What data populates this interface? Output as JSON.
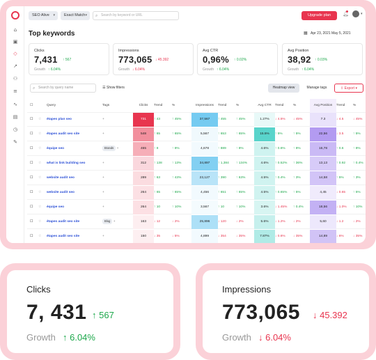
{
  "topbar": {
    "project": "SEO Alive",
    "match": "Exact Match",
    "search_placeholder": "Search by keyword or URL",
    "upgrade": "Upgrade plan"
  },
  "page": {
    "title": "Top keywords",
    "date_range": "Apr 23, 2021   May 5, 2021"
  },
  "metrics": [
    {
      "label": "Clicks",
      "value": "7,431",
      "change": "↑ 567",
      "change_dir": "up",
      "growth_label": "Growth",
      "growth": "↑ 6.04%",
      "growth_dir": "up"
    },
    {
      "label": "Impressions",
      "value": "773,065",
      "change": "↓ 45.392",
      "change_dir": "down",
      "growth_label": "Growth",
      "growth": "↓ 6.04%",
      "growth_dir": "down"
    },
    {
      "label": "Avg CTR",
      "value": "0,96%",
      "change": "↑ 0.02%",
      "change_dir": "up",
      "growth_label": "Growth",
      "growth": "↑ 6.04%",
      "growth_dir": "up"
    },
    {
      "label": "Avg Position",
      "value": "38,92",
      "change": "↑ 0.03%",
      "change_dir": "up",
      "growth_label": "Growth",
      "growth": "↑ 6.04%",
      "growth_dir": "up"
    }
  ],
  "controls": {
    "query_search": "Search by query name",
    "show_filters": "Show filters",
    "heatmap": "Heatmap view",
    "manage_tags": "Manage tags",
    "export": "Export"
  },
  "table": {
    "headers": [
      "Query",
      "Tags",
      "Clicks",
      "Trend",
      "%",
      "Impressions",
      "Trend",
      "%",
      "Avg CTR",
      "Trend",
      "%",
      "Avg Position",
      "Trend",
      "%"
    ],
    "rows": [
      {
        "query": "étapes plan seo",
        "tag": "",
        "clicks": "731",
        "ctrend": "↑ 43",
        "cpct": "↑ 45%",
        "impr": "37,567",
        "itrend": "↑ 455",
        "ipct": "↑ 45%",
        "ctr": "1.27%",
        "trtrend": "↓ 4.5%",
        "trpct": "↓ 45%",
        "pos": "7.3",
        "ptrend": "↓ 4.5",
        "ppct": "↓ 45%"
      },
      {
        "query": "étapes audit seo site",
        "tag": "",
        "clicks": "548",
        "ctrend": "↑ 65",
        "cpct": "↑ 65%",
        "impr": "5,567",
        "itrend": "↑ 653",
        "ipct": "↑ 65%",
        "ctr": "15.5%",
        "trtrend": "↑ 5%",
        "trpct": "↑ 5%",
        "pos": "22,56",
        "ptrend": "↓ 3.5",
        "ppct": "↑ 5%"
      },
      {
        "query": "équipe seo",
        "tag": "Brands",
        "clicks": "465",
        "ctrend": "↑ 8",
        "cpct": "↑ 8%",
        "impr": "4,678",
        "itrend": "↑ 889",
        "ipct": "↑ 8%",
        "ctr": "4.6%",
        "trtrend": "↑ 0.6%",
        "trpct": "↑ 8%",
        "pos": "16,78",
        "ptrend": "↑ 0.6",
        "ppct": "↑ 8%"
      },
      {
        "query": "what is link building seo",
        "tag": "",
        "clicks": "312",
        "ctrend": "↑ 138",
        "cpct": "↑ 13%",
        "impr": "34,897",
        "itrend": "↑ 1,384",
        "ipct": "↑ 134%",
        "ctr": "4.6%",
        "trtrend": "↑ 0.52%",
        "trpct": "↑ 36%",
        "pos": "13,13",
        "ptrend": "↑ 0.92",
        "ppct": "↑ 0.4%"
      },
      {
        "query": "website audit seo",
        "tag": "",
        "clicks": "289",
        "ctrend": "↑ 63",
        "cpct": "↑ 43%",
        "impr": "23,127",
        "itrend": "↑ 390",
        "ipct": "↑ 63%",
        "ctr": "4.5%",
        "trtrend": "↑ 0.4%",
        "trpct": "↑ 3%",
        "pos": "14,58",
        "ptrend": "↑ 5%",
        "ppct": "↑ 3%"
      },
      {
        "query": "website audit seo",
        "tag": "",
        "clicks": "264",
        "ctrend": "↑ 65",
        "cpct": "↑ 65%",
        "impr": "4,456",
        "itrend": "↑ 651",
        "ipct": "↑ 65%",
        "ctr": "4.5%",
        "trtrend": "↑ 0.65%",
        "trpct": "↑ 5%",
        "pos": "4,45",
        "ptrend": "↓ 0.65",
        "ppct": "↑ 5%"
      },
      {
        "query": "équipe seo",
        "tag": "",
        "clicks": "264",
        "ctrend": "↑ 10",
        "cpct": "↑ 10%",
        "impr": "3,567",
        "itrend": "↑ 10",
        "ipct": "↑ 10%",
        "ctr": "3.6%",
        "trtrend": "↓ 1.45%",
        "trpct": "↑ 0.4%",
        "pos": "18,56",
        "ptrend": "↓ 1.0%",
        "ppct": "↑ 10%"
      },
      {
        "query": "étapes audit seo site",
        "tag": "Blog",
        "clicks": "163",
        "ctrend": "↓ 12",
        "cpct": "↓ 2%",
        "impr": "25,896",
        "itrend": "↓ 120",
        "ipct": "↓ 2%",
        "ctr": "5.6%",
        "trtrend": "↓ 1.2%",
        "trpct": "↓ 2%",
        "pos": "5,60",
        "ptrend": "↓ 1.2",
        "ppct": "↓ 2%"
      },
      {
        "query": "étapes audit seo site",
        "tag": "",
        "clicks": "150",
        "ctrend": "↓ 35",
        "cpct": "↓ 5%",
        "impr": "4,899",
        "itrend": "↓ 354",
        "ipct": "↓ 35%",
        "ctr": "7.87%",
        "trtrend": "↓ 0.6%",
        "trpct": "↓ 35%",
        "pos": "14,89",
        "ptrend": "↓ 6%",
        "ppct": "↓ 35%"
      }
    ]
  },
  "big_cards": [
    {
      "label": "Clicks",
      "value": "7, 431",
      "change": "↑ 567",
      "change_dir": "up",
      "growth_label": "Growth",
      "growth": "↑ 6.04%",
      "growth_dir": "up"
    },
    {
      "label": "Impressions",
      "value": "773,065",
      "change": "↓ 45.392",
      "change_dir": "down",
      "growth_label": "Growth",
      "growth": "↓ 6.04%",
      "growth_dir": "down"
    }
  ],
  "colors": {
    "accent": "#e8354f",
    "up": "#1ea84c",
    "down": "#e8354f",
    "frame": "#fbd1d8"
  }
}
